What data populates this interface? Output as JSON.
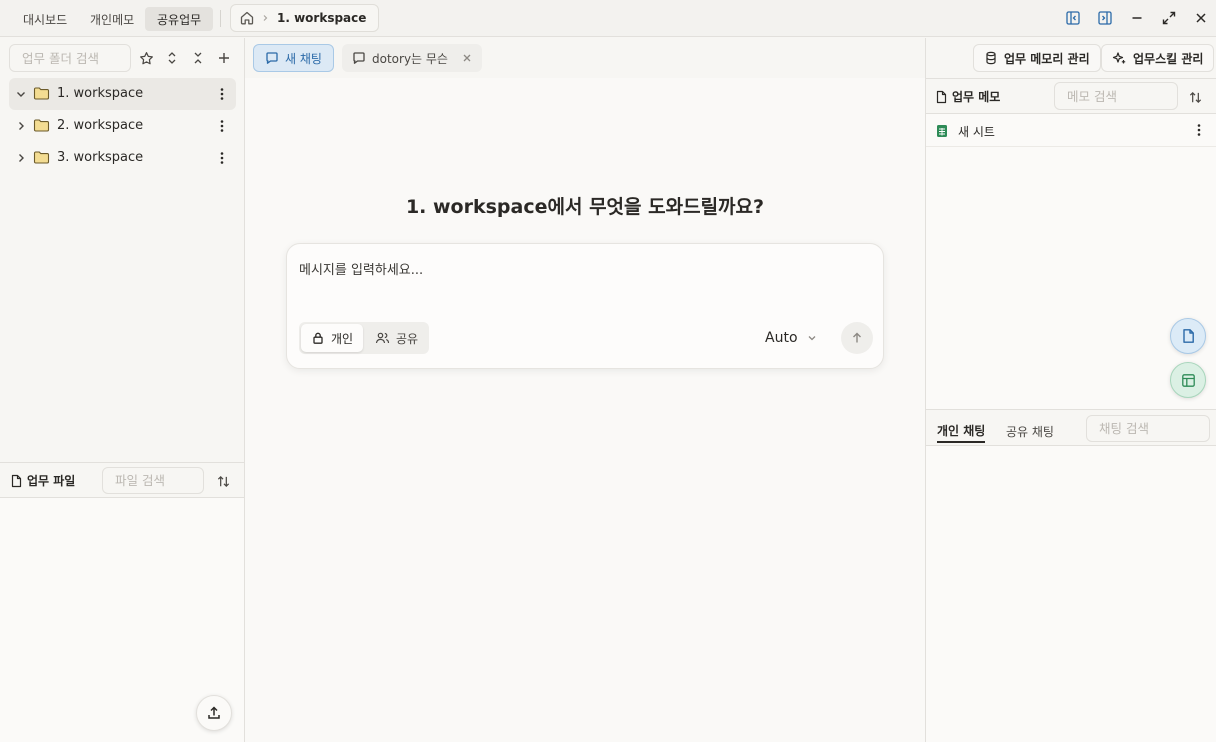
{
  "titlebar": {
    "tabs": [
      {
        "label": "대시보드",
        "active": false
      },
      {
        "label": "개인메모",
        "active": false
      },
      {
        "label": "공유업무",
        "active": true
      }
    ],
    "breadcrumb": {
      "home_icon": "home-icon",
      "current": "1. workspace"
    },
    "window_controls": [
      "panel-left-icon",
      "panel-right-icon",
      "minimize-icon",
      "maximize-icon",
      "close-icon"
    ]
  },
  "sidebar": {
    "search_placeholder": "업무 폴더 검색",
    "folders": [
      {
        "label": "1. workspace",
        "expanded": true,
        "selected": true
      },
      {
        "label": "2. workspace",
        "expanded": false,
        "selected": false
      },
      {
        "label": "3. workspace",
        "expanded": false,
        "selected": false
      }
    ],
    "files": {
      "title": "업무 파일",
      "search_placeholder": "파일 검색"
    }
  },
  "chat": {
    "tabs": [
      {
        "label": "새 채팅",
        "active": true
      },
      {
        "label": "dotory는 무슨",
        "active": false,
        "closable": true
      }
    ],
    "welcome": "1. workspace에서 무엇을 도와드릴까요?",
    "composer": {
      "placeholder": "메시지를 입력하세요...",
      "scope_options": [
        {
          "label": "개인",
          "active": true
        },
        {
          "label": "공유",
          "active": false
        }
      ],
      "model": "Auto"
    }
  },
  "right_panel": {
    "memory_button": "업무 메모리 관리",
    "skill_button": "업무스킬 관리",
    "memo": {
      "title": "업무 메모",
      "search_placeholder": "메모 검색",
      "items": [
        {
          "label": "새 시트",
          "type": "sheet"
        }
      ]
    },
    "chat_list": {
      "tabs": [
        {
          "label": "개인 채팅",
          "active": true
        },
        {
          "label": "공유 채팅",
          "active": false
        }
      ],
      "search_placeholder": "채팅 검색"
    }
  },
  "colors": {
    "accent_blue": "#2b6aa8",
    "accent_blue_bg": "#dce9f5",
    "accent_green": "#2e8b57",
    "folder_fill": "#f3dc92",
    "folder_stroke": "#6b5a2a"
  }
}
